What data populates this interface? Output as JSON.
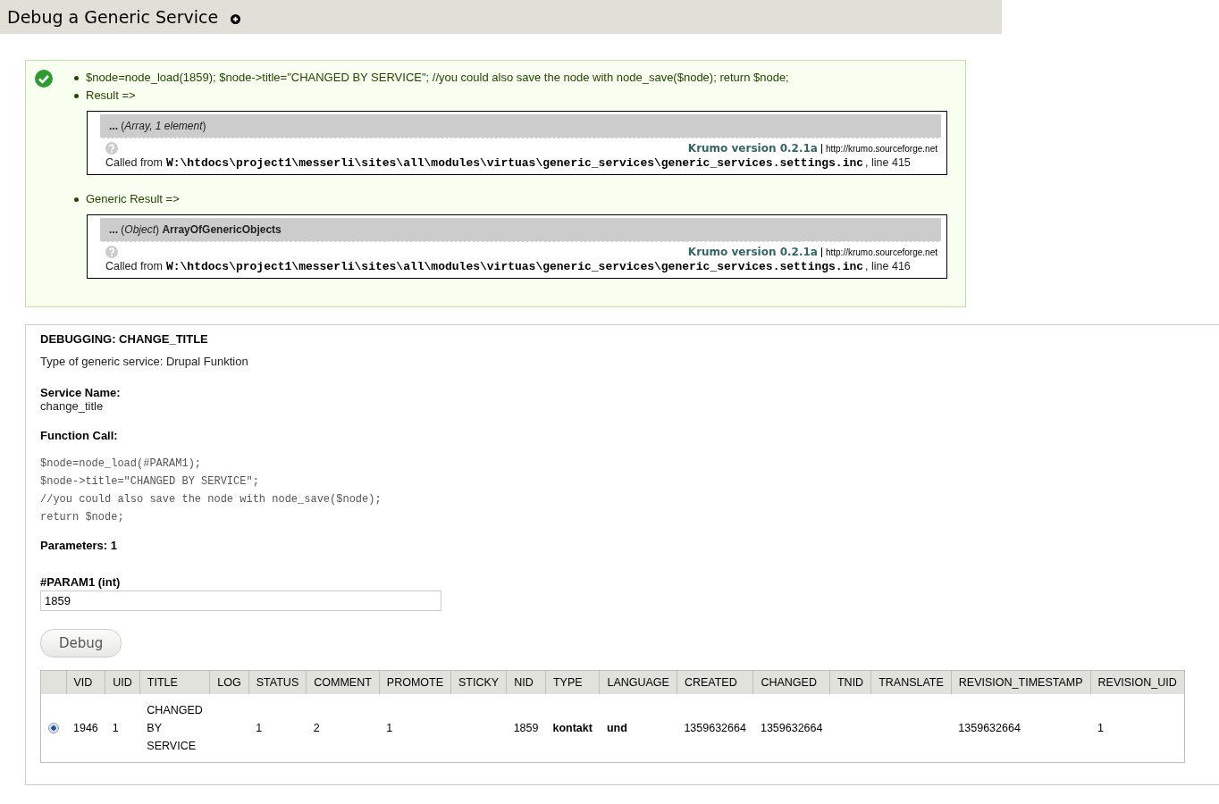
{
  "page": {
    "title": "Debug a Generic Service"
  },
  "message": {
    "kind": "success",
    "items": [
      {
        "text": "$node=node_load(1859); $node->title=\"CHANGED BY SERVICE\"; //you could also save the node with node_save($node); return $node;"
      },
      {
        "text": "Result =>",
        "dump": {
          "summary": "**...** (*Array, 1 element*)",
          "version": "Krumo version 0.2.1a",
          "url": "http://krumo.sourceforge.net",
          "called_from": "Called from",
          "path": "W:\\htdocs\\project1\\messerli\\sites\\all\\modules\\virtuas\\generic_services\\generic_services.settings.inc",
          "line": ", line 415"
        }
      },
      {
        "text": "Generic Result =>",
        "dump": {
          "summary": "**...** (*Object*) **ArrayOfGenericObjects**",
          "version": "Krumo version 0.2.1a",
          "url": "http://krumo.sourceforge.net",
          "called_from": "Called from",
          "path": "W:\\htdocs\\project1\\messerli\\sites\\all\\modules\\virtuas\\generic_services\\generic_services.settings.inc",
          "line": ", line 416"
        }
      }
    ]
  },
  "panel": {
    "heading": "DEBUGGING: CHANGE_TITLE",
    "type_line": "Type of generic service: Drupal Funktion",
    "service_name_label": "Service Name:",
    "service_name": "change_title",
    "function_call_label": "Function Call:",
    "code_lines": [
      "$node=node_load(#PARAM1);",
      "$node->title=\"CHANGED BY SERVICE\";",
      "//you could also save the node with node_save($node);",
      "return $node;"
    ],
    "parameters": "Parameters: 1",
    "param_label": "#PARAM1 (int)",
    "param_value": "1859",
    "button": "Debug"
  },
  "table": {
    "columns": [
      "VID",
      "UID",
      "TITLE",
      "LOG",
      "STATUS",
      "COMMENT",
      "PROMOTE",
      "STICKY",
      "NID",
      "TYPE",
      "LANGUAGE",
      "CREATED",
      "CHANGED",
      "TNID",
      "TRANSLATE",
      "REVISION_TIMESTAMP",
      "REVISION_UID"
    ],
    "rows": [
      {
        "selected": true,
        "cells": [
          "1946",
          "1",
          "CHANGED BY SERVICE",
          null,
          "1",
          "2",
          "1",
          null,
          "1859",
          "kontakt",
          "und",
          "1359632664",
          "1359632664",
          null,
          null,
          "1359632664",
          "1"
        ]
      }
    ]
  }
}
